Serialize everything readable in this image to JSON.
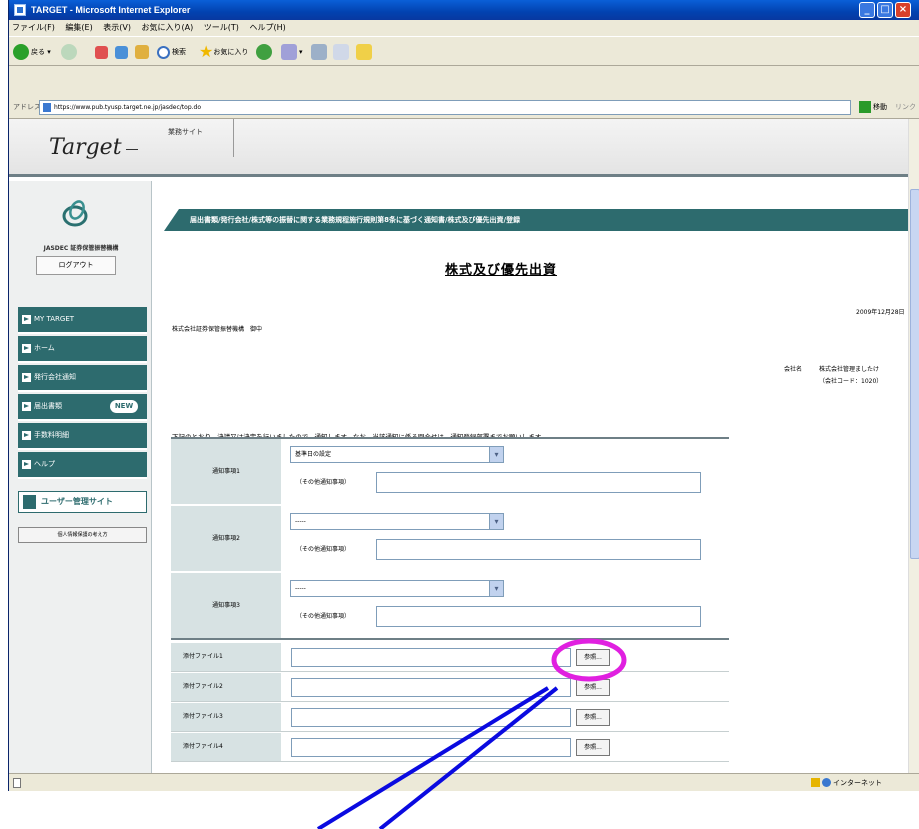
{
  "window": {
    "title": "TARGET - Microsoft Internet Explorer",
    "controls": [
      "_",
      "□",
      "×"
    ]
  },
  "menubar": [
    "ファイル(F)",
    "編集(E)",
    "表示(V)",
    "お気に入り(A)",
    "ツール(T)",
    "ヘルプ(H)"
  ],
  "toolbar": {
    "back": "戻る",
    "search": "検索",
    "favorites": "お気に入り"
  },
  "address": {
    "label": "アドレス(D)",
    "url": "https://www.pub.tyusp.target.ne.jp/jasdec/top.do",
    "go": "移動",
    "links": "リンク"
  },
  "header": {
    "logo": "Target",
    "tab": "業務サイト"
  },
  "sidebar": {
    "org": "JASDEC 証券保管振替機構",
    "logout": "ログアウト",
    "items": [
      {
        "label": "MY TARGET"
      },
      {
        "label": "ホーム"
      },
      {
        "label": "発行会社通知"
      },
      {
        "label": "届出書類",
        "badge": "NEW"
      },
      {
        "label": "手数料明細"
      },
      {
        "label": "ヘルプ"
      }
    ],
    "user_admin": "ユーザー管理サイト",
    "privacy": "個人情報保護の考え方"
  },
  "main": {
    "banner": "届出書類/発行会社/株式等の振替に関する業務規程施行規則第8条に基づく通知書/株式及び優先出資/登録",
    "title": "株式及び優先出資",
    "date": "2009年12月28日",
    "addressee": "株式会社証券保管振替機構　御中",
    "company_label": "会社名",
    "company_name": "株式会社管理ましたけ",
    "company_code": "（会社コード：1020）",
    "notice": "下記のとおり、決議又は決定を行いましたので、通知します。なお、当該通知に係る問合せは、通知登録部署までお願いします。",
    "notify_items": [
      {
        "label": "通知事項1",
        "select": "基準日の設定",
        "other_label": "（その他通知事項）"
      },
      {
        "label": "通知事項2",
        "select": "-----",
        "other_label": "（その他通知事項）"
      },
      {
        "label": "通知事項3",
        "select": "-----",
        "other_label": "（その他通知事項）"
      }
    ],
    "files": [
      {
        "label": "添付ファイル1",
        "button": "参照..."
      },
      {
        "label": "添付ファイル2",
        "button": "参照..."
      },
      {
        "label": "添付ファイル3",
        "button": "参照..."
      },
      {
        "label": "添付ファイル4",
        "button": "参照..."
      }
    ]
  },
  "status": {
    "zone": "インターネット"
  },
  "colors": {
    "teal": "#2d6b6e",
    "annotation_circle": "#e020e0",
    "annotation_line": "#0a0ae0"
  }
}
